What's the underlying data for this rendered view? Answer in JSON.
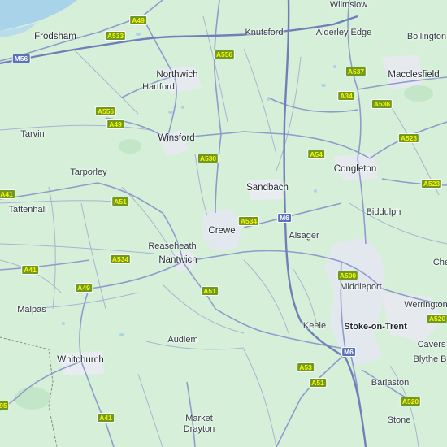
{
  "colors": {
    "land": "#d6efd9",
    "water": "#a9d3e8",
    "road": "#9aa7c9",
    "motorway": "#7f8fbd",
    "urban": "#e3e7ee",
    "primary_shield_bg": "#6e9a22",
    "primary_shield_fg": "#fff200",
    "motorway_shield_bg": "#5a73b8",
    "motorway_shield_fg": "#ffffff"
  },
  "places": [
    {
      "id": "wilmslow",
      "name": "Wilmslow"
    },
    {
      "id": "frodsham",
      "name": "Frodsham"
    },
    {
      "id": "knutsford",
      "name": "Knutsford"
    },
    {
      "id": "alderley-edge",
      "name": "Alderley Edge"
    },
    {
      "id": "bollington",
      "name": "Bollington"
    },
    {
      "id": "northwich",
      "name": "Northwich"
    },
    {
      "id": "hartford",
      "name": "Hartford"
    },
    {
      "id": "macclesfield",
      "name": "Macclesfield"
    },
    {
      "id": "tarvin",
      "name": "Tarvin"
    },
    {
      "id": "winsford",
      "name": "Winsford"
    },
    {
      "id": "tarporley",
      "name": "Tarporley"
    },
    {
      "id": "congleton",
      "name": "Congleton"
    },
    {
      "id": "sandbach",
      "name": "Sandbach"
    },
    {
      "id": "tattenhall",
      "name": "Tattenhall"
    },
    {
      "id": "biddulph",
      "name": "Biddulph"
    },
    {
      "id": "crewe",
      "name": "Crewe"
    },
    {
      "id": "alsager",
      "name": "Alsager"
    },
    {
      "id": "reaseheath",
      "name": "Reaseheath"
    },
    {
      "id": "nantwich",
      "name": "Nantwich"
    },
    {
      "id": "middleport",
      "name": "Middleport"
    },
    {
      "id": "che",
      "name": "Che"
    },
    {
      "id": "malpas",
      "name": "Malpas"
    },
    {
      "id": "werrington",
      "name": "Werrington"
    },
    {
      "id": "keele",
      "name": "Keele"
    },
    {
      "id": "stoke",
      "name": "Stoke-on-Trent"
    },
    {
      "id": "audlem",
      "name": "Audlem"
    },
    {
      "id": "caverswall",
      "name": "Cavers"
    },
    {
      "id": "whitchurch",
      "name": "Whitchurch"
    },
    {
      "id": "blythe-bridge",
      "name": "Blythe B"
    },
    {
      "id": "barlaston",
      "name": "Barlaston"
    },
    {
      "id": "market-drayton-1",
      "name": "Market"
    },
    {
      "id": "market-drayton-2",
      "name": "Drayton"
    },
    {
      "id": "stone",
      "name": "Stone"
    }
  ],
  "road_shields": [
    {
      "id": "a49-north",
      "label": "A49",
      "type": "primary"
    },
    {
      "id": "a533",
      "label": "A533",
      "type": "primary"
    },
    {
      "id": "m56",
      "label": "M56",
      "type": "motorway"
    },
    {
      "id": "a556-east",
      "label": "A556",
      "type": "primary"
    },
    {
      "id": "a537",
      "label": "A537",
      "type": "primary"
    },
    {
      "id": "a34",
      "label": "A34",
      "type": "primary"
    },
    {
      "id": "a556-west",
      "label": "A556",
      "type": "primary"
    },
    {
      "id": "a536",
      "label": "A536",
      "type": "primary"
    },
    {
      "id": "a49-mid",
      "label": "A49",
      "type": "primary"
    },
    {
      "id": "a523-north",
      "label": "A523",
      "type": "primary"
    },
    {
      "id": "a54",
      "label": "A54",
      "type": "primary"
    },
    {
      "id": "a530",
      "label": "A530",
      "type": "primary"
    },
    {
      "id": "a523-south",
      "label": "A523",
      "type": "primary"
    },
    {
      "id": "a41-north",
      "label": "A41",
      "type": "primary"
    },
    {
      "id": "a51-north",
      "label": "A51",
      "type": "primary"
    },
    {
      "id": "m6-north",
      "label": "M6",
      "type": "motorway"
    },
    {
      "id": "a534-east",
      "label": "A534",
      "type": "primary"
    },
    {
      "id": "a534-west",
      "label": "A534",
      "type": "primary"
    },
    {
      "id": "a41-mid",
      "label": "A41",
      "type": "primary"
    },
    {
      "id": "a500",
      "label": "A500",
      "type": "primary"
    },
    {
      "id": "a49-south",
      "label": "A49",
      "type": "primary"
    },
    {
      "id": "a51-mid",
      "label": "A51",
      "type": "primary"
    },
    {
      "id": "a520-east",
      "label": "A520",
      "type": "primary"
    },
    {
      "id": "m6-south",
      "label": "M6",
      "type": "motorway"
    },
    {
      "id": "a53",
      "label": "A53",
      "type": "primary"
    },
    {
      "id": "a51-south",
      "label": "A51",
      "type": "primary"
    },
    {
      "id": "a520-south",
      "label": "A520",
      "type": "primary"
    },
    {
      "id": "a495",
      "label": "95",
      "type": "primary"
    },
    {
      "id": "a41-south",
      "label": "A41",
      "type": "primary"
    }
  ]
}
